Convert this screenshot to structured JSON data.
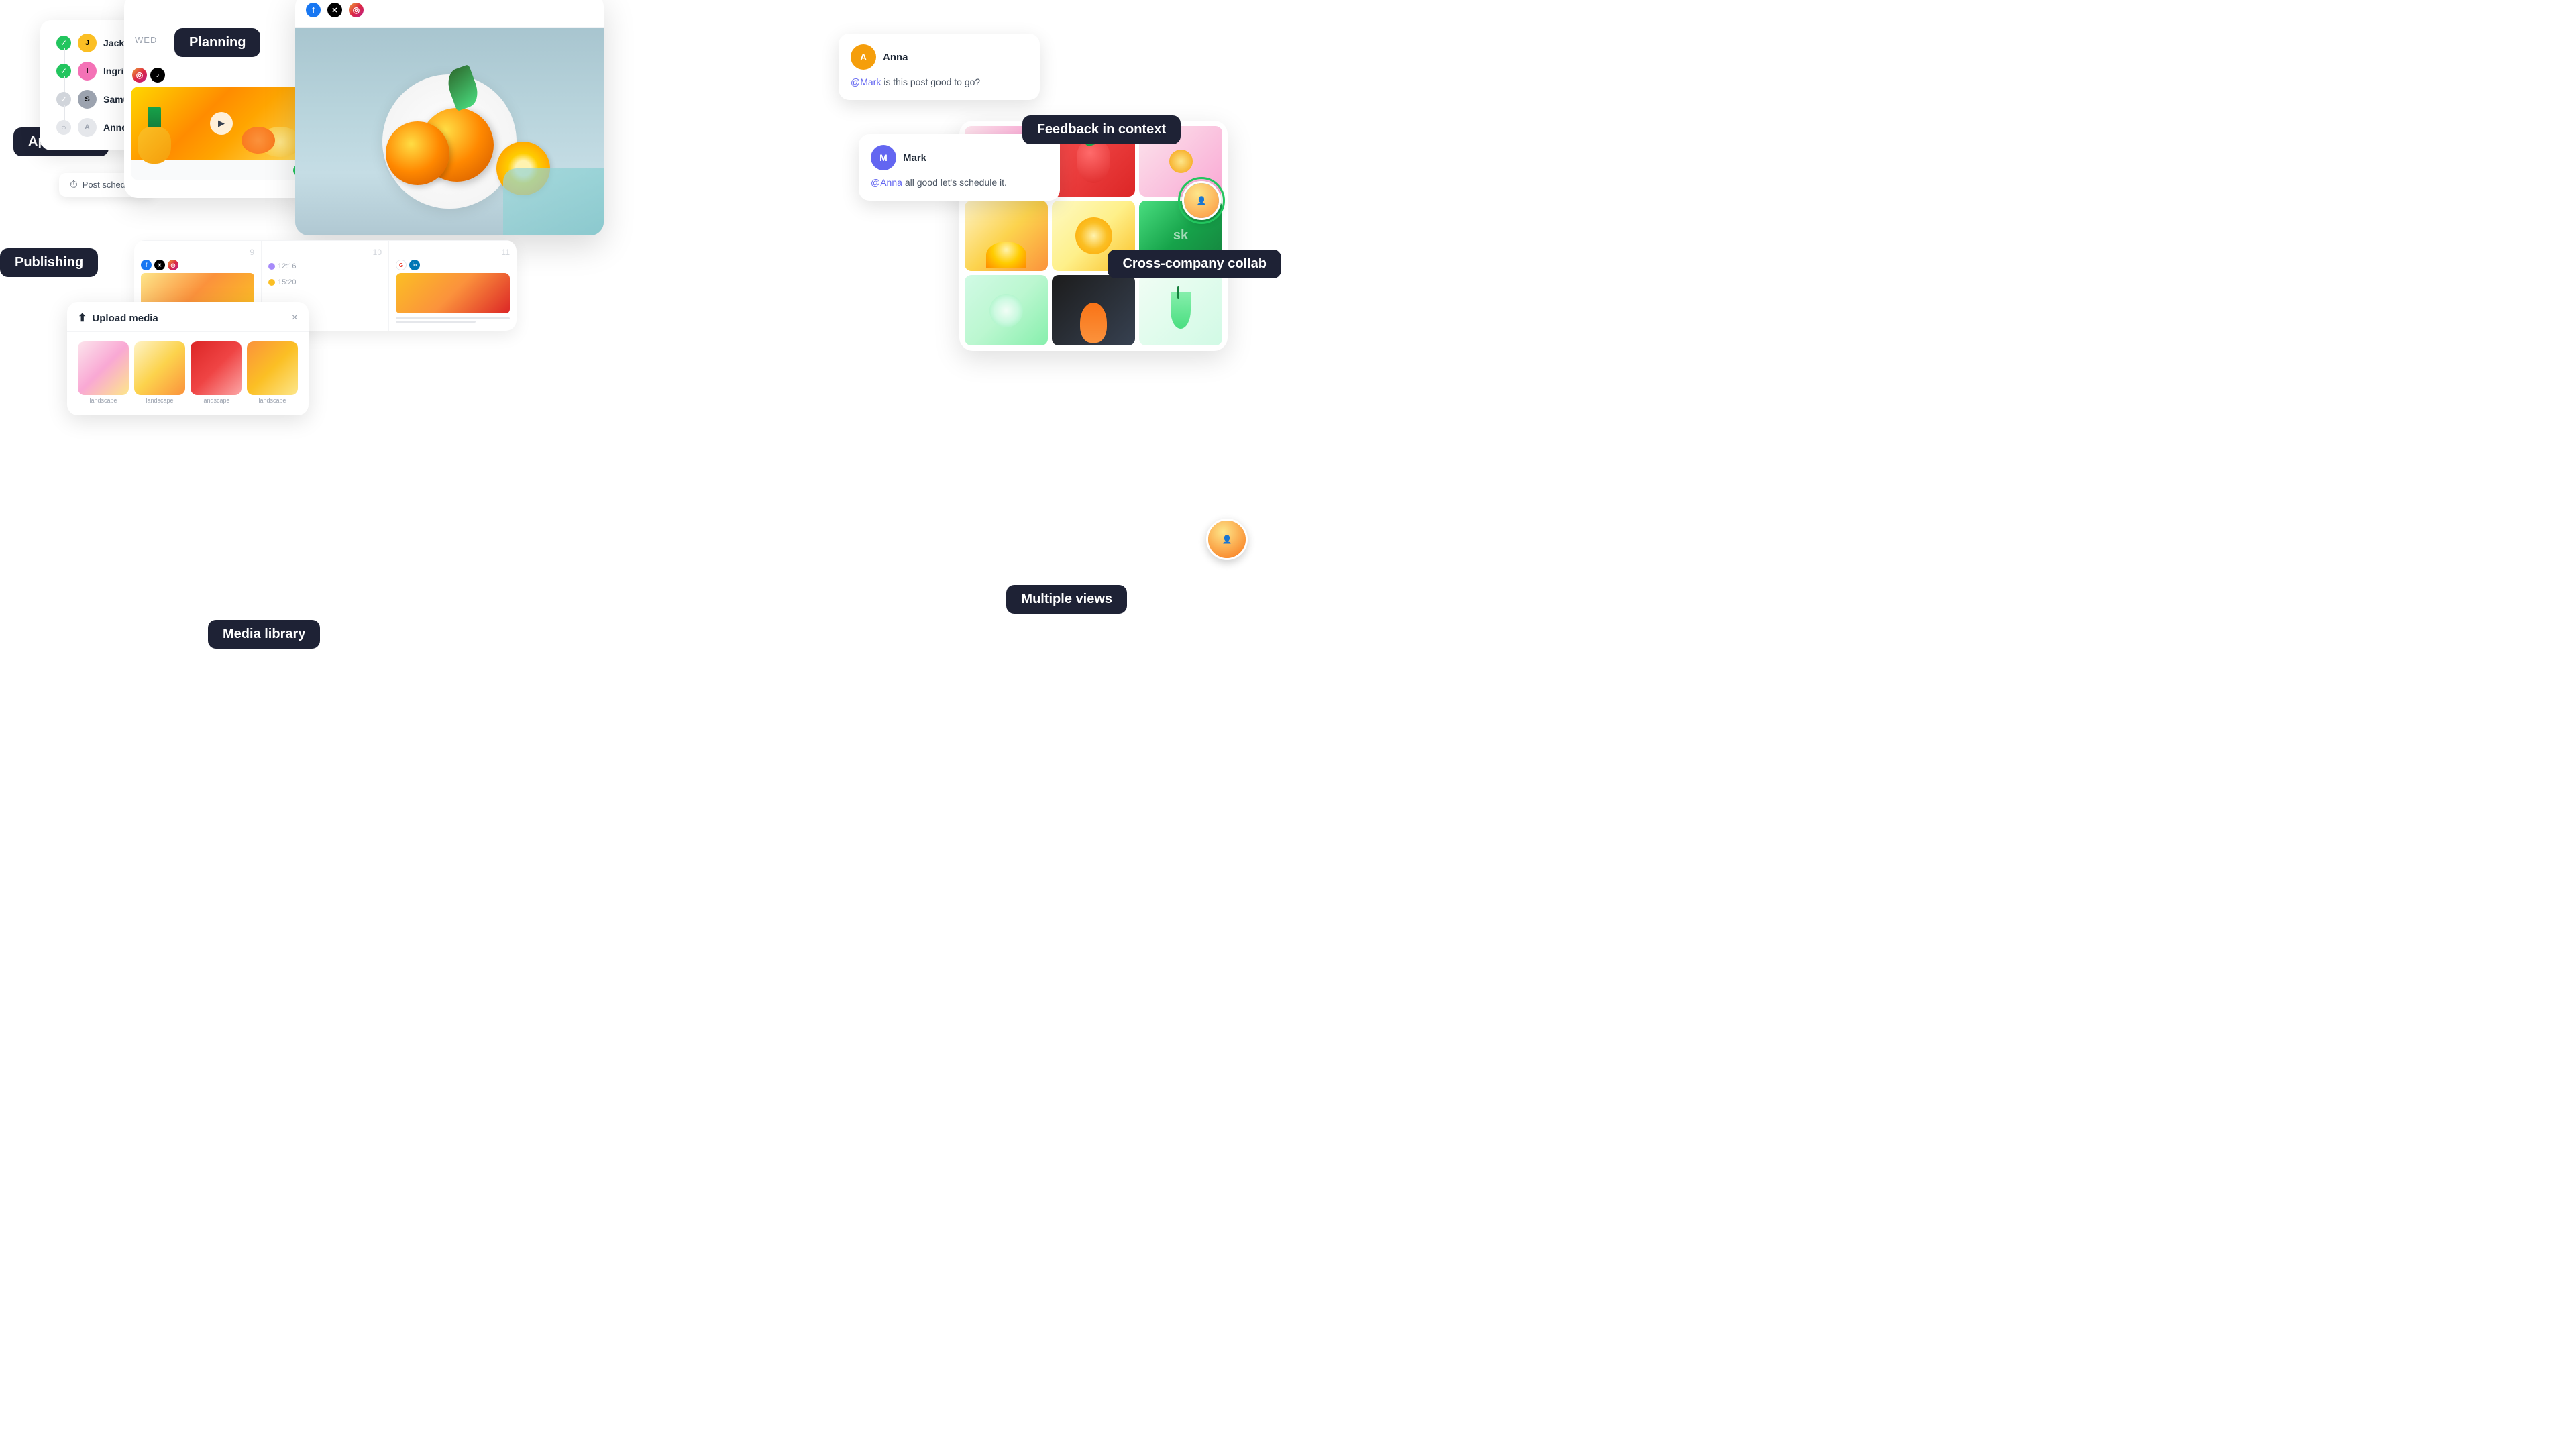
{
  "labels": {
    "approvals": "Approvals",
    "planning": "Planning",
    "publishing": "Publishing",
    "feedback": "Feedback in context",
    "media_library": "Media library",
    "upload_media": "Upload media",
    "multiple_views": "Multiple views",
    "cross_company": "Cross-company collab",
    "post_scheduled": "Post scheduled"
  },
  "approvals": {
    "users": [
      {
        "name": "Jack",
        "status": "green"
      },
      {
        "name": "Ingrid",
        "status": "green"
      },
      {
        "name": "Samuel",
        "status": "gray"
      },
      {
        "name": "Anne",
        "status": "light"
      }
    ]
  },
  "feedback_cards": [
    {
      "author": "Anna",
      "avatar_color": "#f59e0b",
      "text": "@Mark is this post good to go?",
      "mention": "@Mark"
    },
    {
      "author": "Mark",
      "avatar_color": "#6366f1",
      "text": "@Anna all good let's schedule it.",
      "mention": "@Anna"
    }
  ],
  "calendar": {
    "header_day": "WED",
    "days": [
      "9",
      "10",
      "11"
    ],
    "time1": "12:16",
    "time2": "15:20"
  },
  "upload": {
    "title": "Upload media",
    "close": "×",
    "image_labels": [
      "landscape",
      "landscape",
      "landscape",
      "landscape"
    ]
  },
  "social_icons": {
    "fb": "f",
    "x": "✕",
    "ig": "◎",
    "tiktok": "♪",
    "google": "G",
    "linkedin": "in"
  }
}
